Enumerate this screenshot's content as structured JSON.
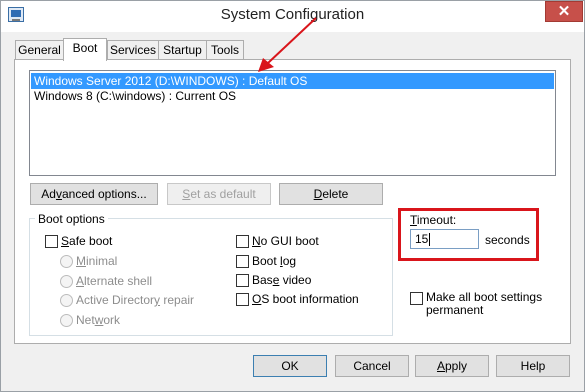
{
  "window": {
    "title": "System Configuration",
    "close_glyph": "✕"
  },
  "tabs": [
    {
      "label": "General"
    },
    {
      "label": "Boot"
    },
    {
      "label": "Services"
    },
    {
      "label": "Startup"
    },
    {
      "label": "Tools"
    }
  ],
  "os_list": [
    {
      "label": "Windows Server 2012 (D:\\WINDOWS) : Default OS",
      "selected": true
    },
    {
      "label": "Windows 8 (C:\\windows) : Current OS",
      "selected": false
    }
  ],
  "list_buttons": {
    "advanced_pre": "Ad",
    "advanced_key": "v",
    "advanced_post": "anced options...",
    "set_default_pre": "",
    "set_default_key": "S",
    "set_default_post": "et as default",
    "delete_pre": "",
    "delete_key": "D",
    "delete_post": "elete"
  },
  "boot_options": {
    "group_label": "Boot options",
    "safe_boot_key": "S",
    "safe_boot_post": "afe boot",
    "minimal_key": "M",
    "minimal_post": "inimal",
    "alternate_shell_key": "A",
    "alternate_shell_post": "lternate shell",
    "ad_repair_pre": "Active Director",
    "ad_repair_key": "y",
    "ad_repair_post": " repair",
    "network_pre": "Net",
    "network_key": "w",
    "network_post": "ork",
    "no_gui_key": "N",
    "no_gui_post": "o GUI boot",
    "boot_log_pre": "Boot ",
    "boot_log_key": "l",
    "boot_log_post": "og",
    "base_video_pre": "Bas",
    "base_video_key": "e",
    "base_video_post": " video",
    "os_info_key": "O",
    "os_info_post": "S boot information"
  },
  "timeout": {
    "label_key": "T",
    "label_post": "imeout:",
    "value": "15",
    "unit": "seconds",
    "highlight_color": "#d9151b"
  },
  "make_permanent": {
    "line1_pre": "Make all boot settings",
    "line2_post": "permanent"
  },
  "footer": {
    "ok": "OK",
    "cancel": "Cancel",
    "apply_key": "A",
    "apply_post": "pply",
    "help": "Help"
  },
  "annotation": {
    "arrow_color": "#d9151b"
  }
}
